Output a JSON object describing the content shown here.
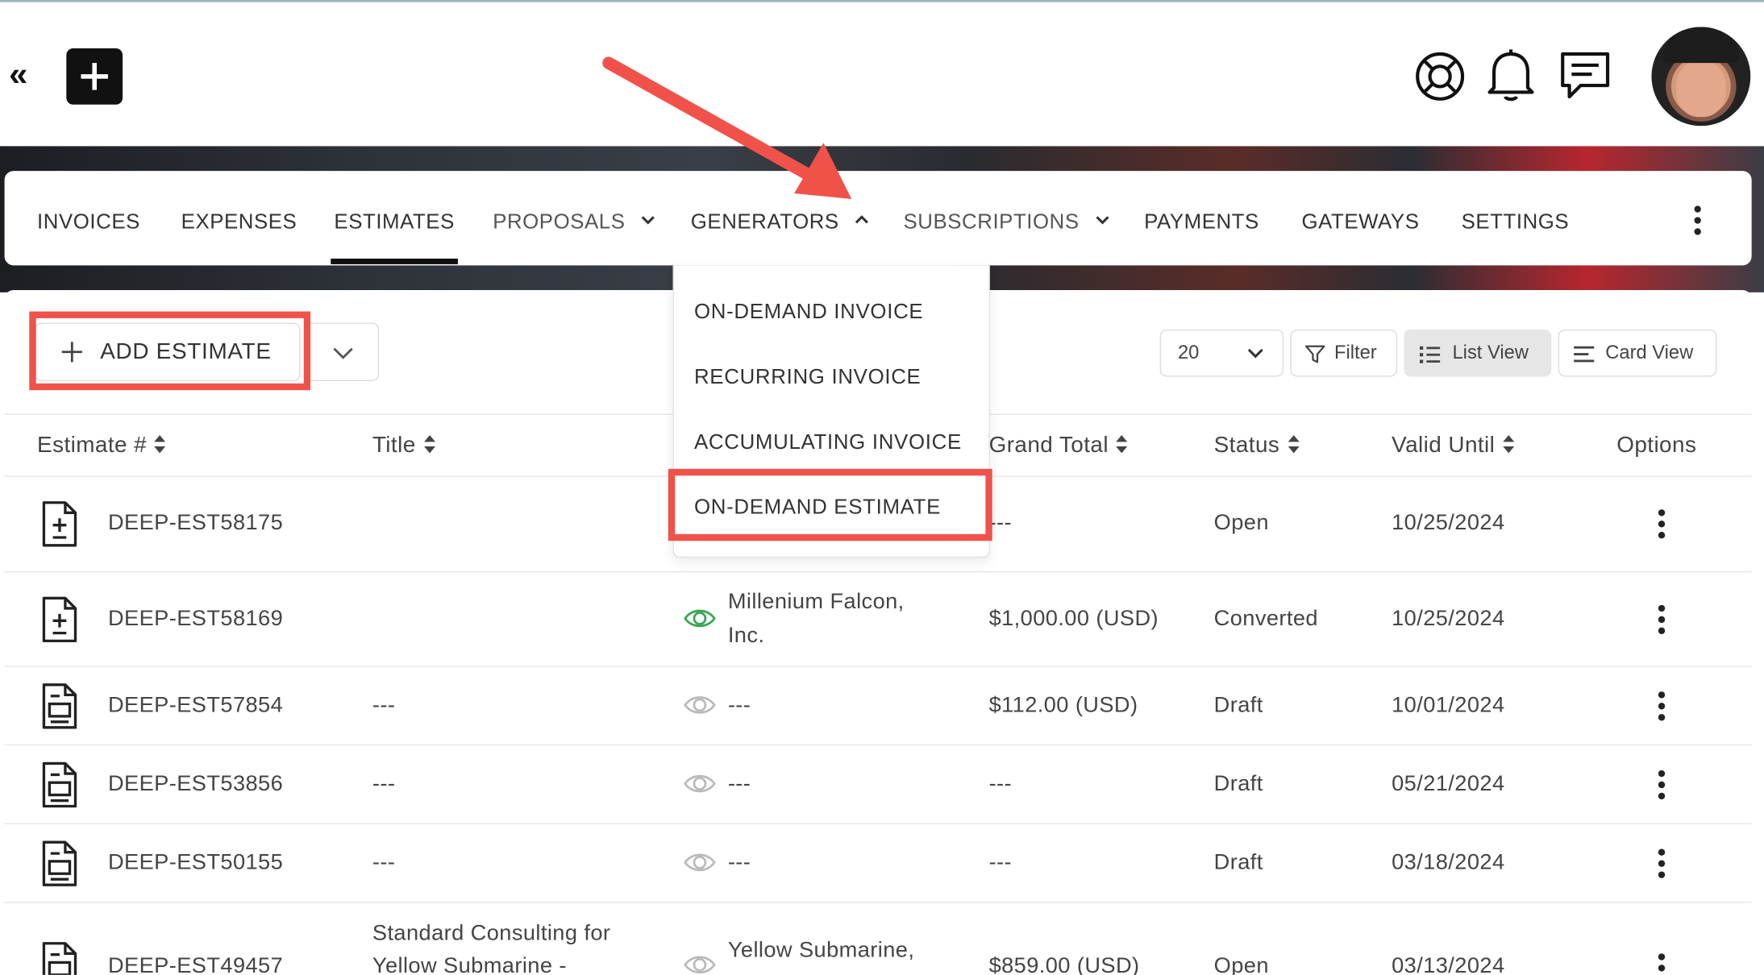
{
  "colors": {
    "annotation_red": "#f0524a",
    "text": "#333333",
    "green_eye": "#3aa655",
    "grey_eye": "#bbbbbb"
  },
  "topbar": {
    "collapse_icon": "double-chevron-left-icon",
    "add_icon": "plus-icon",
    "icons": [
      "lifebuoy-icon",
      "bell-icon",
      "chat-icon"
    ],
    "avatar": "user-avatar"
  },
  "nav": {
    "tabs": [
      {
        "label": "INVOICES"
      },
      {
        "label": "EXPENSES"
      },
      {
        "label": "ESTIMATES",
        "active": true
      },
      {
        "label": "PROPOSALS",
        "has_dropdown": true
      },
      {
        "label": "GENERATORS",
        "has_dropdown": true,
        "expanded": true
      },
      {
        "label": "SUBSCRIPTIONS",
        "has_dropdown": true
      },
      {
        "label": "PAYMENTS"
      },
      {
        "label": "GATEWAYS"
      },
      {
        "label": "SETTINGS"
      }
    ],
    "more_icon": "kebab-vertical-icon"
  },
  "generators_menu": {
    "items": [
      {
        "label": "ON-DEMAND INVOICE"
      },
      {
        "label": "RECURRING INVOICE"
      },
      {
        "label": "ACCUMULATING INVOICE"
      },
      {
        "label": "ON-DEMAND ESTIMATE",
        "highlighted": true
      }
    ]
  },
  "toolbar": {
    "add_label": "ADD ESTIMATE",
    "per_page": "20",
    "filter_label": "Filter",
    "list_view_label": "List View",
    "card_view_label": "Card View"
  },
  "table": {
    "headers": {
      "estimate": "Estimate #",
      "title": "Title",
      "grand_total": "Grand Total",
      "status": "Status",
      "valid_until": "Valid Until",
      "options": "Options"
    },
    "rows": [
      {
        "number": "DEEP-EST58175",
        "title": "",
        "client_line1": "",
        "client_line2": "",
        "total": "---",
        "status": "Open",
        "valid": "10/25/2024",
        "icon": "document-plus-minus-icon"
      },
      {
        "number": "DEEP-EST58169",
        "title": "",
        "client_line1": "Millenium Falcon,",
        "client_line2": "Inc.",
        "total": "$1,000.00 (USD)",
        "status": "Converted",
        "valid": "10/25/2024",
        "icon": "document-plus-minus-icon",
        "eye": "green"
      },
      {
        "number": "DEEP-EST57854",
        "title": "---",
        "client_line1": "---",
        "client_line2": "",
        "total": "$112.00 (USD)",
        "status": "Draft",
        "valid": "10/01/2024",
        "icon": "document-draft-icon",
        "eye": "grey"
      },
      {
        "number": "DEEP-EST53856",
        "title": "---",
        "client_line1": "---",
        "client_line2": "",
        "total": "---",
        "status": "Draft",
        "valid": "05/21/2024",
        "icon": "document-draft-icon",
        "eye": "grey"
      },
      {
        "number": "DEEP-EST50155",
        "title": "---",
        "client_line1": "---",
        "client_line2": "",
        "total": "---",
        "status": "Draft",
        "valid": "03/18/2024",
        "icon": "document-draft-icon",
        "eye": "grey"
      },
      {
        "number": "DEEP-EST49457",
        "title_line1": "Standard Consulting for",
        "title_line2": "Yellow Submarine -",
        "client_line1": "Yellow Submarine,",
        "client_line2": "",
        "total": "$859.00 (USD)",
        "status": "Open",
        "valid": "03/13/2024",
        "icon": "document-draft-icon",
        "eye": "grey"
      }
    ]
  }
}
